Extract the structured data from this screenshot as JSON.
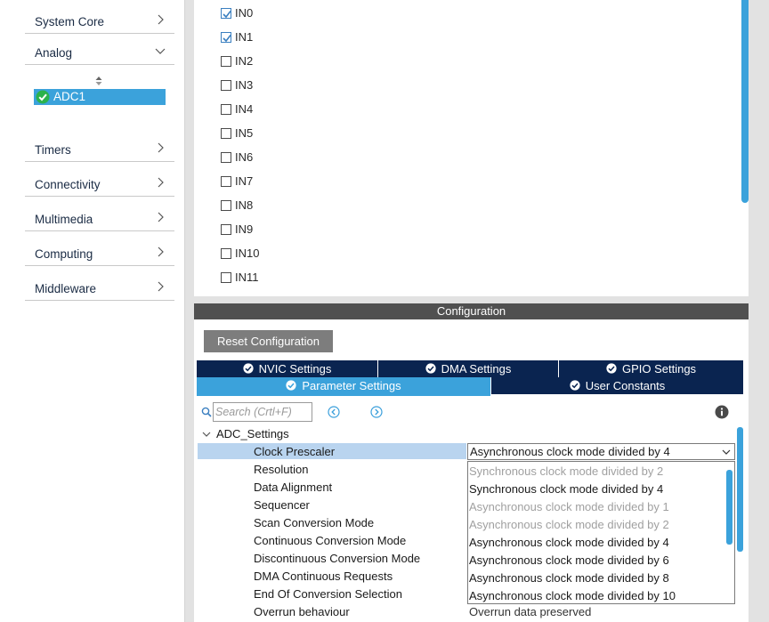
{
  "categories": [
    {
      "label": "System Core",
      "expanded": false
    },
    {
      "label": "Analog",
      "expanded": true
    },
    {
      "label": "Timers",
      "expanded": false
    },
    {
      "label": "Connectivity",
      "expanded": false
    },
    {
      "label": "Multimedia",
      "expanded": false
    },
    {
      "label": "Computing",
      "expanded": false
    },
    {
      "label": "Middleware",
      "expanded": false
    }
  ],
  "analog_items": [
    {
      "label": "ADC1",
      "status": "ok",
      "selected": true
    }
  ],
  "channels": [
    {
      "label": "IN0",
      "checked": true
    },
    {
      "label": "IN1",
      "checked": true
    },
    {
      "label": "IN2",
      "checked": false
    },
    {
      "label": "IN3",
      "checked": false
    },
    {
      "label": "IN4",
      "checked": false
    },
    {
      "label": "IN5",
      "checked": false
    },
    {
      "label": "IN6",
      "checked": false
    },
    {
      "label": "IN7",
      "checked": false
    },
    {
      "label": "IN8",
      "checked": false
    },
    {
      "label": "IN9",
      "checked": false
    },
    {
      "label": "IN10",
      "checked": false
    },
    {
      "label": "IN11",
      "checked": false
    }
  ],
  "config": {
    "header": "Configuration",
    "reset_label": "Reset Configuration",
    "tabs_row1": [
      "NVIC Settings",
      "DMA Settings",
      "GPIO Settings"
    ],
    "tabs_row2": [
      "Parameter Settings",
      "User Constants"
    ],
    "active_tab": "Parameter Settings",
    "search_placeholder": "Search (Crtl+F)",
    "group_label": "ADC_Settings",
    "parameters": [
      "Clock Prescaler",
      "Resolution",
      "Data Alignment",
      "Sequencer",
      "Scan Conversion Mode",
      "Continuous Conversion Mode",
      "Discontinuous Conversion Mode",
      "DMA Continuous Requests",
      "End Of Conversion Selection",
      "Overrun behaviour"
    ],
    "prescaler_value": "Asynchronous clock mode divided by 4",
    "prescaler_options": [
      {
        "label": "Synchronous clock mode divided by 2",
        "enabled": false
      },
      {
        "label": "Synchronous clock mode divided by 4",
        "enabled": true
      },
      {
        "label": "Asynchronous clock mode divided by 1",
        "enabled": false
      },
      {
        "label": "Asynchronous clock mode divided by 2",
        "enabled": false
      },
      {
        "label": "Asynchronous clock mode divided by 4",
        "enabled": true
      },
      {
        "label": "Asynchronous clock mode divided by 6",
        "enabled": true
      },
      {
        "label": "Asynchronous clock mode divided by 8",
        "enabled": true
      },
      {
        "label": "Asynchronous clock mode divided by 10",
        "enabled": true
      }
    ],
    "overrun_value": "Overrun data preserved"
  },
  "colors": {
    "accent": "#3ba2db",
    "tab_dark": "#0a2450",
    "header_bg": "#505050",
    "status_ok": "#2bb24c",
    "disabled_text": "#a0a0a0"
  },
  "icons": {
    "chevron": "chevron-right-icon",
    "expanded": "chevron-down-icon",
    "status": "check-circle-icon",
    "search": "search-icon",
    "info": "info-icon"
  }
}
